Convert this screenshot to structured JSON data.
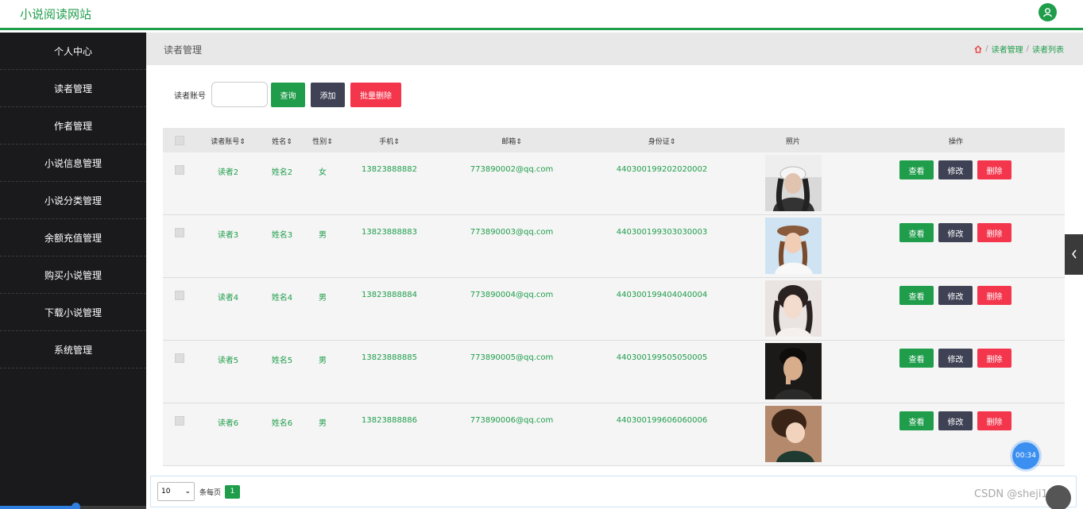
{
  "header": {
    "title": "小说阅读网站",
    "avatar_icon": "user-icon"
  },
  "sidebar": {
    "items": [
      {
        "label": "个人中心"
      },
      {
        "label": "读者管理"
      },
      {
        "label": "作者管理"
      },
      {
        "label": "小说信息管理"
      },
      {
        "label": "小说分类管理"
      },
      {
        "label": "余额充值管理"
      },
      {
        "label": "购买小说管理"
      },
      {
        "label": "下载小说管理"
      },
      {
        "label": "系统管理"
      }
    ]
  },
  "page": {
    "title": "读者管理",
    "breadcrumb": [
      "读者管理",
      "读者列表"
    ]
  },
  "search": {
    "label": "读者账号",
    "placeholder": "",
    "search_button": "查询",
    "add_button": "添加",
    "batch_delete_button": "批量删除"
  },
  "table": {
    "columns": [
      "读者账号",
      "姓名",
      "性别",
      "手机",
      "邮箱",
      "身份证",
      "照片",
      "操作"
    ],
    "rows": [
      {
        "account": "读者2",
        "name": "姓名2",
        "gender": "女",
        "phone": "13823888882",
        "email": "773890002@qq.com",
        "id_card": "440300199202020002"
      },
      {
        "account": "读者3",
        "name": "姓名3",
        "gender": "男",
        "phone": "13823888883",
        "email": "773890003@qq.com",
        "id_card": "440300199303030003"
      },
      {
        "account": "读者4",
        "name": "姓名4",
        "gender": "男",
        "phone": "13823888884",
        "email": "773890004@qq.com",
        "id_card": "440300199404040004"
      },
      {
        "account": "读者5",
        "name": "姓名5",
        "gender": "男",
        "phone": "13823888885",
        "email": "773890005@qq.com",
        "id_card": "440300199505050005"
      },
      {
        "account": "读者6",
        "name": "姓名6",
        "gender": "男",
        "phone": "13823888886",
        "email": "773890006@qq.com",
        "id_card": "440300199606060006"
      }
    ],
    "actions": {
      "view": "查看",
      "edit": "修改",
      "delete": "删除"
    }
  },
  "pagination": {
    "page_size": "10",
    "per_page_label": "条每页",
    "current_page": "1"
  },
  "overlay": {
    "timer": "00:34",
    "watermark": "CSDN @sheji1011"
  },
  "colors": {
    "accent": "#1f9d4b",
    "danger": "#f4364c",
    "dark": "#3e4254",
    "sidebar": "#1a1a1c"
  }
}
